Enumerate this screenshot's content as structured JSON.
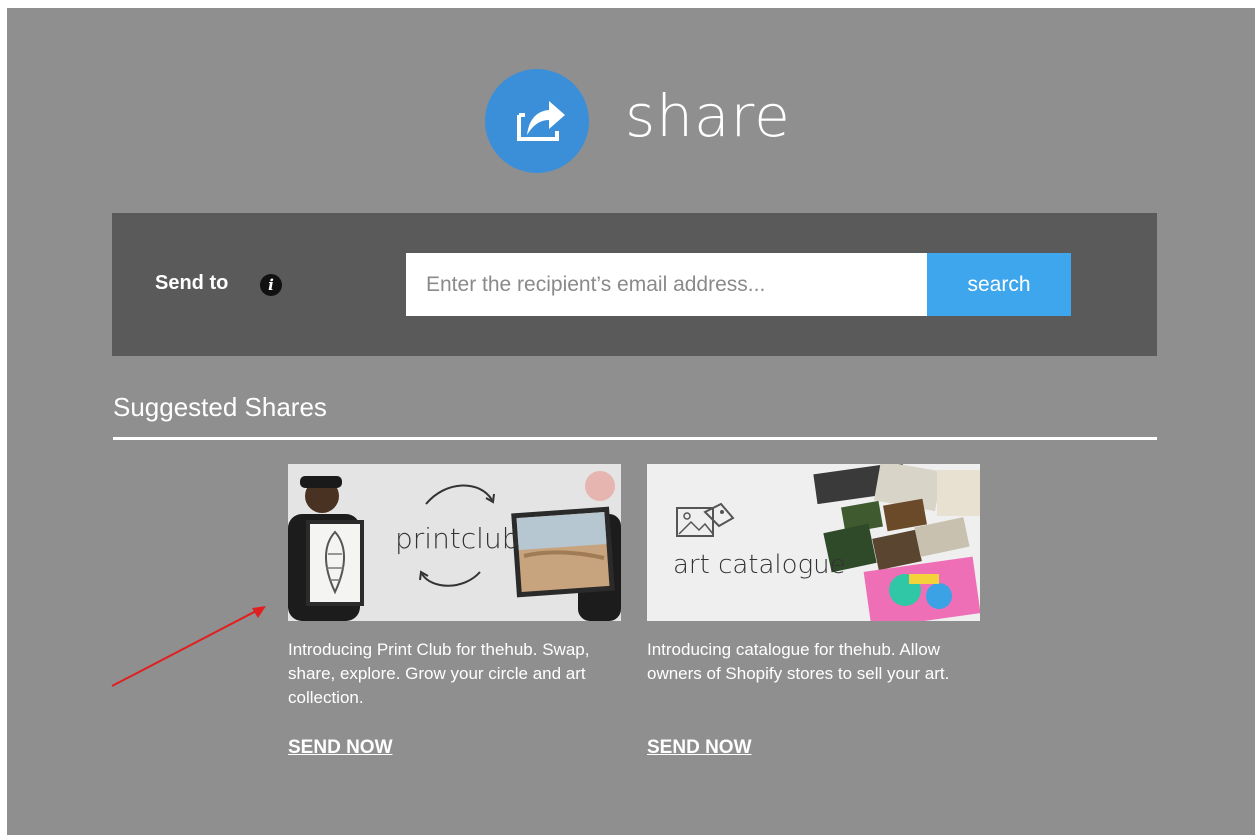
{
  "header": {
    "logo_icon": "share-icon",
    "logo_text": "share",
    "logo_color": "#3b8fd9"
  },
  "send_to": {
    "label": "Send to",
    "info_icon": "info-icon",
    "placeholder": "Enter the recipient’s email address...",
    "value": "",
    "button_label": "search",
    "button_color": "#3ea6ec"
  },
  "suggested": {
    "title": "Suggested Shares",
    "cards": [
      {
        "image_text": "printclub",
        "description": "Introducing Print Club for thehub. Swap, share, explore. Grow your circle and art collection.",
        "link_label": "SEND NOW"
      },
      {
        "image_text": "art catalogue",
        "description": "Introducing catalogue for thehub. Allow owners of Shopify stores to sell your art.",
        "link_label": "SEND NOW"
      }
    ]
  },
  "annotation": {
    "arrow_color": "#e02020"
  }
}
